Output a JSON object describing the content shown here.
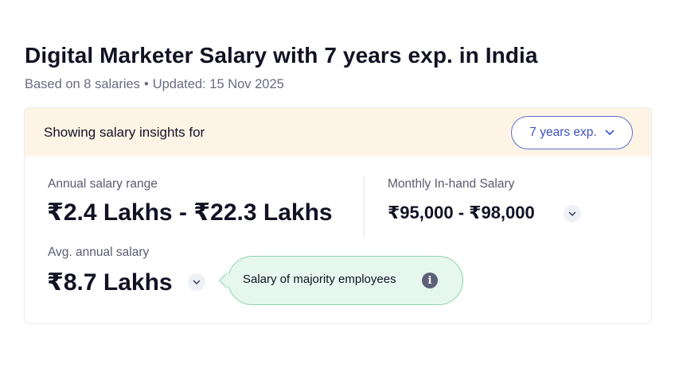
{
  "page": {
    "title": "Digital Marketer Salary with 7 years exp. in India",
    "based_on": "Based on 8 salaries",
    "separator": "•",
    "updated": "Updated: 15 Nov 2025"
  },
  "insights": {
    "showing_label": "Showing salary insights for",
    "experience_selected": "7 years exp.",
    "experience_icon": "chevron-down-icon"
  },
  "annual_range": {
    "label": "Annual salary range",
    "value": "₹2.4 Lakhs - ₹22.3 Lakhs"
  },
  "monthly_inhand": {
    "label": "Monthly In-hand Salary",
    "value": "₹95,000 - ₹98,000",
    "expand_icon": "chevron-down-icon"
  },
  "avg_annual": {
    "label": "Avg. annual salary",
    "value": "₹8.7 Lakhs",
    "expand_icon": "chevron-down-icon"
  },
  "tooltip": {
    "text": "Salary of majority employees",
    "icon": "info-icon",
    "icon_glyph": "i"
  },
  "colors": {
    "header_bg": "#fef4e6",
    "accent": "#3e4fbf",
    "tooltip_bg": "#e6f7ee",
    "tooltip_border": "#8ed3ae"
  }
}
